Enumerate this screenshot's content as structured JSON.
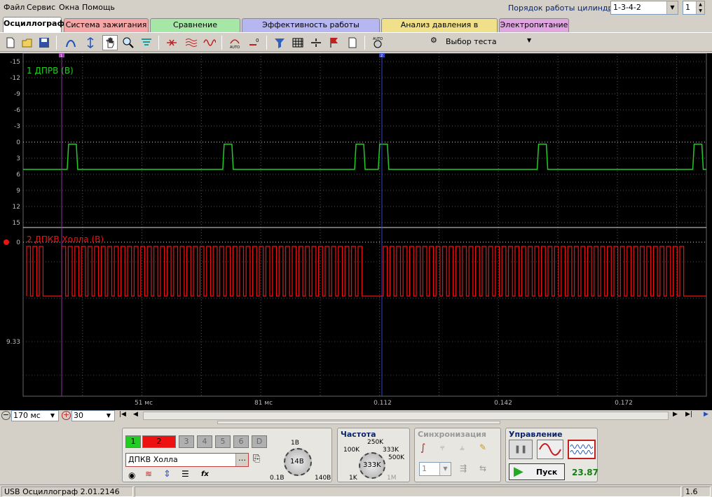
{
  "menu": [
    "Файл",
    "Сервис",
    "Окна",
    "Помощь"
  ],
  "cyl_order": {
    "label": "Порядок работы цилиндров",
    "value": "1-3-4-2",
    "num": "1"
  },
  "tabs": [
    {
      "label": "Осциллограф",
      "color": "#ffffff",
      "active": true
    },
    {
      "label": "Система зажигания",
      "color": "#f4a6a6"
    },
    {
      "label": "Сравнение цилиндров",
      "color": "#a6e6a6"
    },
    {
      "label": "Эффективность работы цилиндров",
      "color": "#b6b6f0"
    },
    {
      "label": "Анализ давления в цилиндре",
      "color": "#f0e08a"
    },
    {
      "label": "Электропитание",
      "color": "#e0a6e0"
    }
  ],
  "toolbar": {
    "test_select": "Выбор теста",
    "auto_label": "AUTO"
  },
  "scope": {
    "ch1": {
      "label": "1 ДПРВ (В)",
      "color": "#22cc22",
      "ticks": [
        "-15",
        "-12",
        "-9",
        "-6",
        "-3",
        "0",
        "3",
        "6",
        "9",
        "12",
        "15"
      ]
    },
    "ch2": {
      "label": "2 ДПКВ Холла (В)",
      "color": "#ee1111",
      "ticks": [
        "0",
        "9.33"
      ]
    },
    "time_ticks": [
      "51 мс",
      "81 мс",
      "0.112",
      "0.142",
      "0.172"
    ],
    "markers": [
      "1",
      "2"
    ],
    "ch1_pulses": [
      0.06,
      0.29,
      0.485,
      0.52,
      0.755,
      0.985
    ]
  },
  "timebar": {
    "timebase": "170 мс",
    "zoom": "30"
  },
  "channels": {
    "buttons": [
      "1",
      "2",
      "3",
      "4",
      "5",
      "6",
      "D"
    ],
    "name": "ДПКВ Холла",
    "sens_labels": [
      "1В",
      "14В",
      "0.1В",
      "140В"
    ]
  },
  "frequency": {
    "title": "Частота",
    "labels": [
      "250K",
      "100K",
      "333K",
      "500K",
      "1K",
      "1M",
      "333K"
    ]
  },
  "sync": {
    "title": "Синхронизация",
    "value": "1"
  },
  "control": {
    "title": "Управление",
    "start": "Пуск",
    "value": "23.87"
  },
  "status": {
    "left": "USB Осциллограф  2.01.2146",
    "right": "1.6"
  }
}
